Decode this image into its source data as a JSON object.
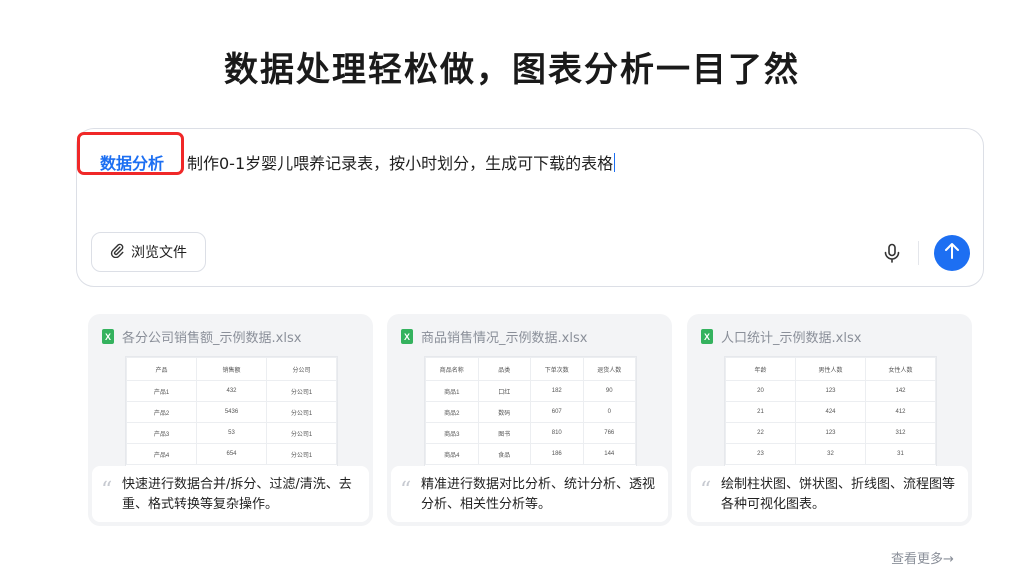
{
  "headline": "数据处理轻松做，图表分析一目了然",
  "prompt": {
    "skill_tag": "数据分析",
    "text": "制作0-1岁婴儿喂养记录表，按小时划分，生成可下载的表格",
    "browse_label": "浏览文件",
    "icons": {
      "attach": "paperclip-icon",
      "mic": "microphone-icon",
      "send": "arrow-up-icon"
    },
    "accent_color": "#1d6ff2",
    "highlight_color": "#f02828"
  },
  "cards": [
    {
      "file_name": "各分公司销售额_示例数据.xlsx",
      "headers": [
        "产品",
        "销售额",
        "分公司"
      ],
      "rows": [
        [
          "产品1",
          "432",
          "分公司1"
        ],
        [
          "产品2",
          "5436",
          "分公司1"
        ],
        [
          "产品3",
          "53",
          "分公司1"
        ],
        [
          "产品4",
          "654",
          "分公司1"
        ]
      ],
      "description": "快速进行数据合并/拆分、过滤/清洗、去重、格式转换等复杂操作。"
    },
    {
      "file_name": "商品销售情况_示例数据.xlsx",
      "headers": [
        "商品名称",
        "品类",
        "下单次数",
        "退货人数"
      ],
      "rows": [
        [
          "商品1",
          "口红",
          "182",
          "90"
        ],
        [
          "商品2",
          "数码",
          "607",
          "0"
        ],
        [
          "商品3",
          "图书",
          "810",
          "766"
        ],
        [
          "商品4",
          "食品",
          "186",
          "144"
        ]
      ],
      "description": "精准进行数据对比分析、统计分析、透视分析、相关性分析等。"
    },
    {
      "file_name": "人口统计_示例数据.xlsx",
      "headers": [
        "年龄",
        "男性人数",
        "女性人数"
      ],
      "rows": [
        [
          "20",
          "123",
          "142"
        ],
        [
          "21",
          "424",
          "412"
        ],
        [
          "22",
          "123",
          "312"
        ],
        [
          "23",
          "32",
          "31"
        ]
      ],
      "description": "绘制柱状图、饼状图、折线图、流程图等各种可视化图表。"
    }
  ],
  "file_badge": "X",
  "see_more": "查看更多→"
}
